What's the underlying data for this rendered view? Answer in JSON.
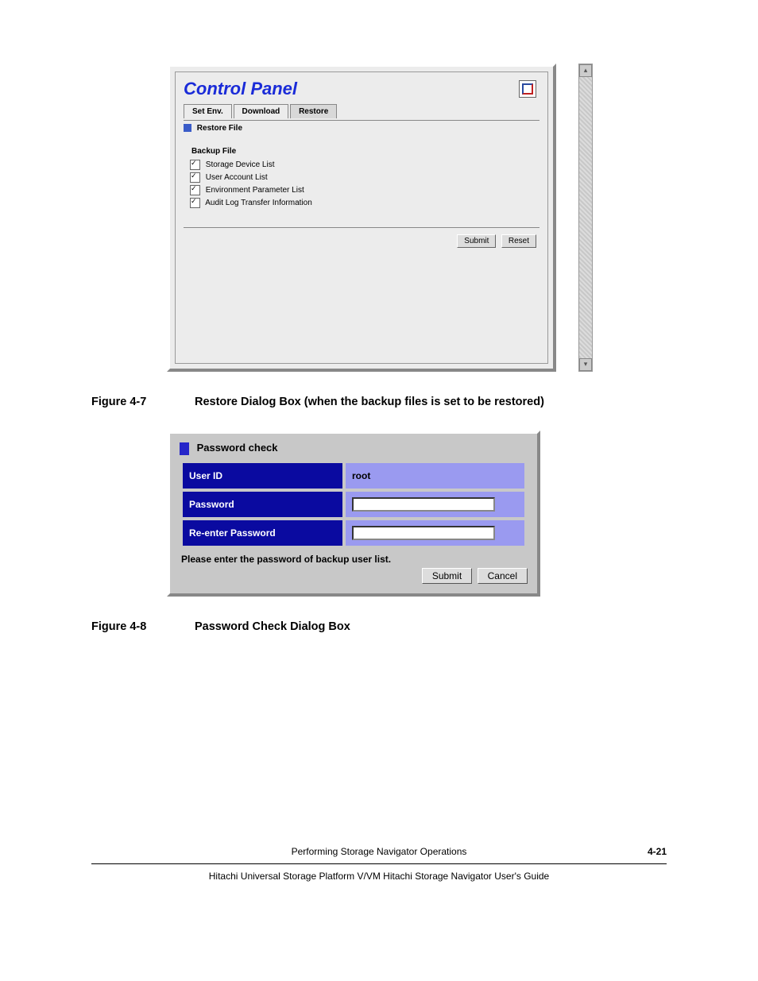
{
  "figure1": {
    "panel_title": "Control Panel",
    "tabs": {
      "setenv": "Set Env.",
      "download": "Download",
      "restore": "Restore"
    },
    "section_label": "Restore File",
    "group_label": "Backup File",
    "checks": {
      "c1": "Storage Device List",
      "c2": "User Account List",
      "c3": "Environment Parameter List",
      "c4": "Audit Log Transfer Information"
    },
    "buttons": {
      "submit": "Submit",
      "reset": "Reset"
    }
  },
  "caption1": {
    "no": "Figure 4-7",
    "text": "Restore Dialog Box (when the backup files is set to be restored)"
  },
  "figure2": {
    "title": "Password check",
    "rows": {
      "userid_label": "User ID",
      "userid_value": "root",
      "password_label": "Password",
      "reenter_label": "Re-enter Password"
    },
    "message": "Please enter the password of backup user list.",
    "buttons": {
      "submit": "Submit",
      "cancel": "Cancel"
    }
  },
  "caption2": {
    "no": "Figure 4-8",
    "text": "Password Check Dialog Box"
  },
  "footer": {
    "line1": "Performing Storage Navigator Operations",
    "page": "4-21",
    "line2": "Hitachi Universal Storage Platform V/VM Hitachi Storage Navigator User's Guide"
  }
}
